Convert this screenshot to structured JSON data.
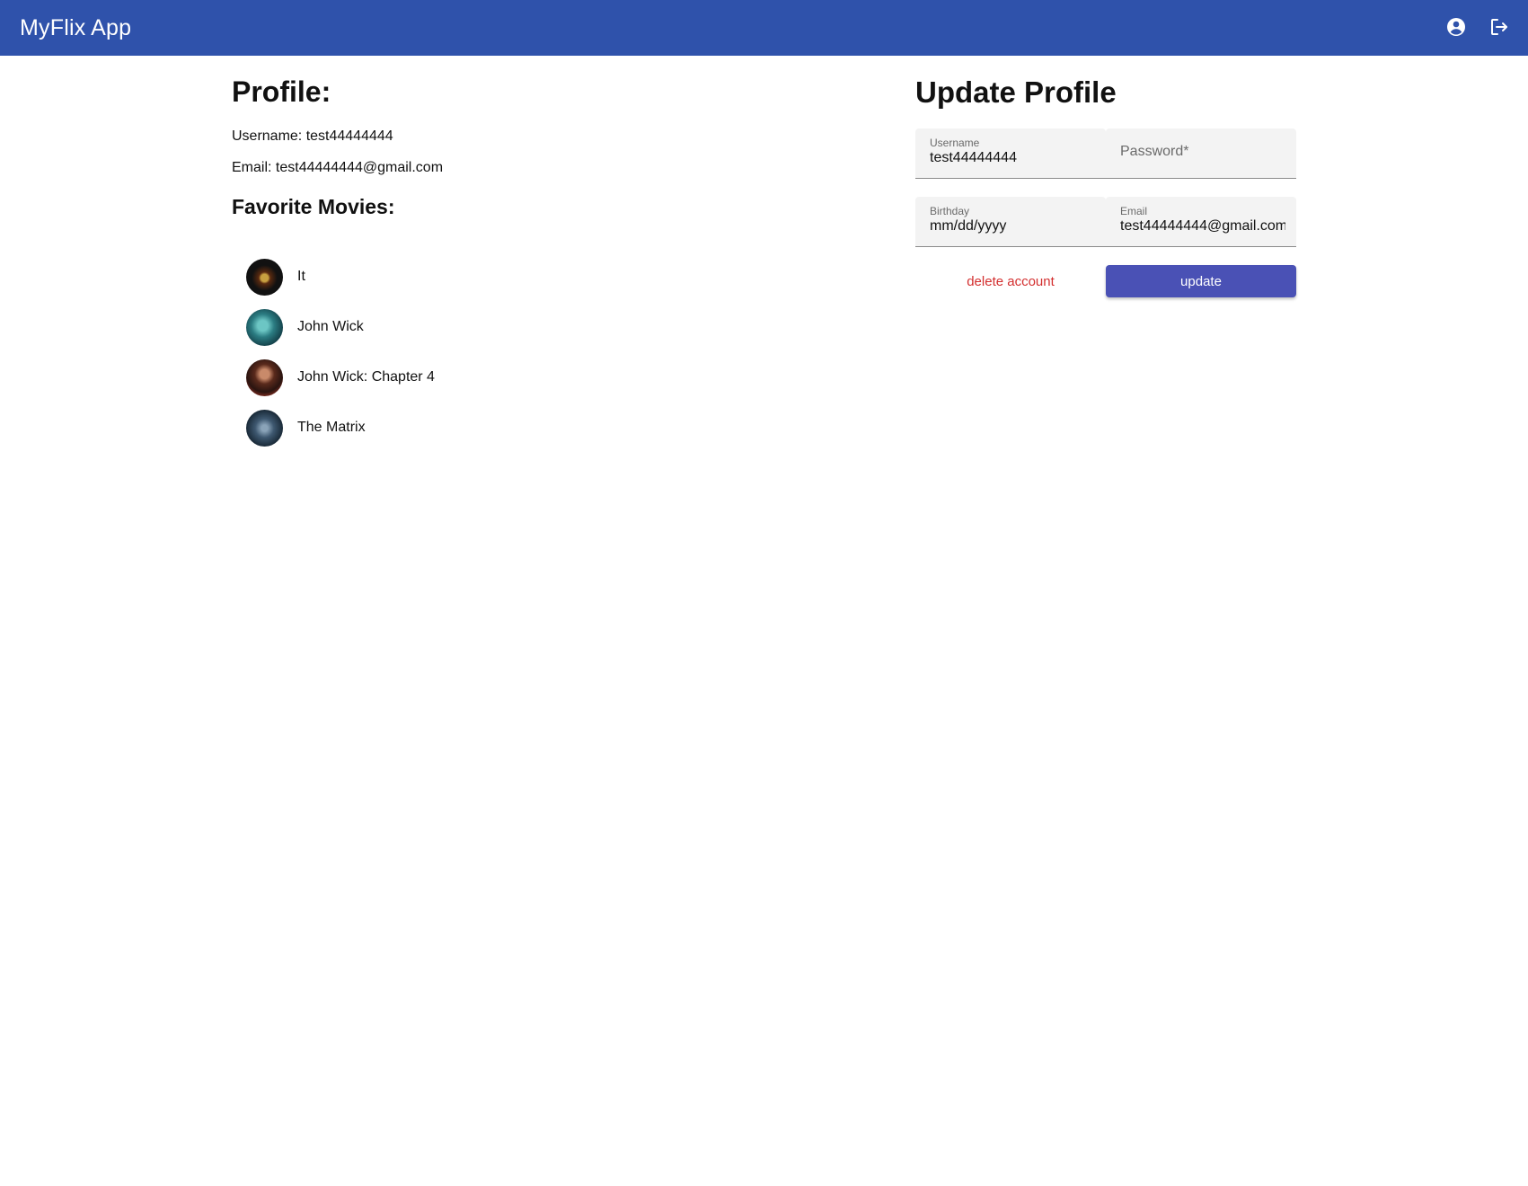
{
  "header": {
    "title": "MyFlix App",
    "account_icon": "account-circle-icon",
    "logout_icon": "logout-icon",
    "bar_color": "#2f52ab"
  },
  "profile": {
    "heading": "Profile:",
    "username_line": "Username: test44444444",
    "email_line": "Email: test44444444@gmail.com",
    "favorites_heading": "Favorite Movies:",
    "favorites": [
      {
        "title": "It"
      },
      {
        "title": "John Wick"
      },
      {
        "title": "John Wick: Chapter 4"
      },
      {
        "title": "The Matrix"
      }
    ]
  },
  "update_form": {
    "heading": "Update Profile",
    "username": {
      "label": "Username",
      "value": "test44444444"
    },
    "password": {
      "placeholder": "Password*",
      "value": ""
    },
    "birthday": {
      "label": "Birthday",
      "placeholder": "mm/dd/yyyy",
      "value": ""
    },
    "email": {
      "label": "Email",
      "value": "test44444444@gmail.com"
    },
    "delete_label": "delete account",
    "update_label": "update",
    "delete_color": "#d32f2f",
    "update_color": "#4a51b5"
  }
}
